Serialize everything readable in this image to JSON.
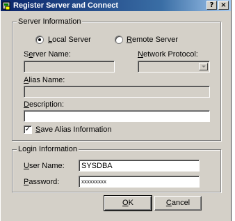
{
  "window": {
    "title": "Register Server and Connect"
  },
  "server_info": {
    "legend": "Server Information",
    "local_pre": "",
    "local_ul": "L",
    "local_post": "ocal Server",
    "remote_pre": "",
    "remote_ul": "R",
    "remote_post": "emote Server",
    "selected": "local",
    "server_name_pre": "S",
    "server_name_ul": "e",
    "server_name_post": "rver Name:",
    "server_name_value": "",
    "protocol_pre": "",
    "protocol_ul": "N",
    "protocol_post": "etwork Protocol:",
    "protocol_value": "",
    "alias_pre": "",
    "alias_ul": "A",
    "alias_post": "lias Name:",
    "alias_value": "",
    "description_pre": "",
    "description_ul": "D",
    "description_post": "escription:",
    "description_value": "",
    "save_alias_pre": "",
    "save_alias_ul": "S",
    "save_alias_post": "ave Alias Information",
    "save_alias_checked": "✓"
  },
  "login_info": {
    "legend": "Login Information",
    "username_pre": "",
    "username_ul": "U",
    "username_post": "ser Name:",
    "username_value": "SYSDBA",
    "password_pre": "",
    "password_ul": "P",
    "password_post": "assword:",
    "password_value": "xxxxxxxxx"
  },
  "buttons": {
    "ok_pre": "",
    "ok_ul": "O",
    "ok_post": "K",
    "cancel_pre": "",
    "cancel_ul": "C",
    "cancel_post": "ancel",
    "help_label": "?",
    "close_label": "×"
  }
}
